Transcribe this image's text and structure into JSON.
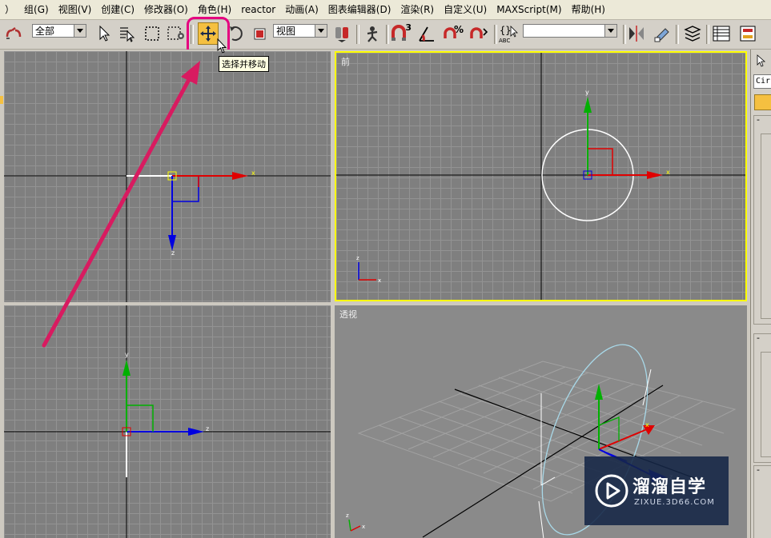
{
  "menubar": {
    "items": [
      "）",
      "组(G)",
      "视图(V)",
      "创建(C)",
      "修改器(O)",
      "角色(H)",
      "reactor",
      "动画(A)",
      "图表编辑器(D)",
      "渲染(R)",
      "自定义(U)",
      "MAXScript(M)",
      "帮助(H)"
    ]
  },
  "toolbar": {
    "selection_filter": "全部",
    "reference_coord": "视图",
    "named_selection": "",
    "snap_3d_label": "3",
    "highlight_color": "#e5007f",
    "icons": [
      "link-icon",
      "select-object-icon",
      "select-by-name-icon",
      "rect-selection-icon",
      "window-crossing-icon",
      "select-and-move-icon",
      "select-and-rotate-icon",
      "select-and-scale-icon",
      "use-pivot-center-icon",
      "manipulate-icon",
      "snap-3d-icon",
      "angle-snap-icon",
      "percent-snap-icon",
      "spinner-snap-icon",
      "edit-named-selection-icon",
      "mirror-icon",
      "align-icon",
      "layer-manager-icon",
      "curve-editor-icon",
      "schematic-view-icon"
    ]
  },
  "tooltip": {
    "text": "选择并移动"
  },
  "viewports": {
    "top": {
      "label": ""
    },
    "front": {
      "label": "前",
      "active": true,
      "active_border": "#ffff00"
    },
    "left": {
      "label": ""
    },
    "perspective": {
      "label": "透视"
    }
  },
  "axis_labels": {
    "x": "x",
    "y": "y",
    "z": "z"
  },
  "command_panel": {
    "dropdown": "Cir",
    "rollout_minus": "-"
  },
  "watermark": {
    "brand": "溜溜自学",
    "url": "ZIXUE.3D66.COM"
  },
  "colors": {
    "x_axis": "#e00000",
    "y_axis": "#00b000",
    "z_axis": "#0000e0",
    "gizmo_highlight": "#ffff00",
    "circle": "#ffffff",
    "perspective_circle": "#a8d8e8",
    "arrow_annotation": "#d81b60"
  }
}
